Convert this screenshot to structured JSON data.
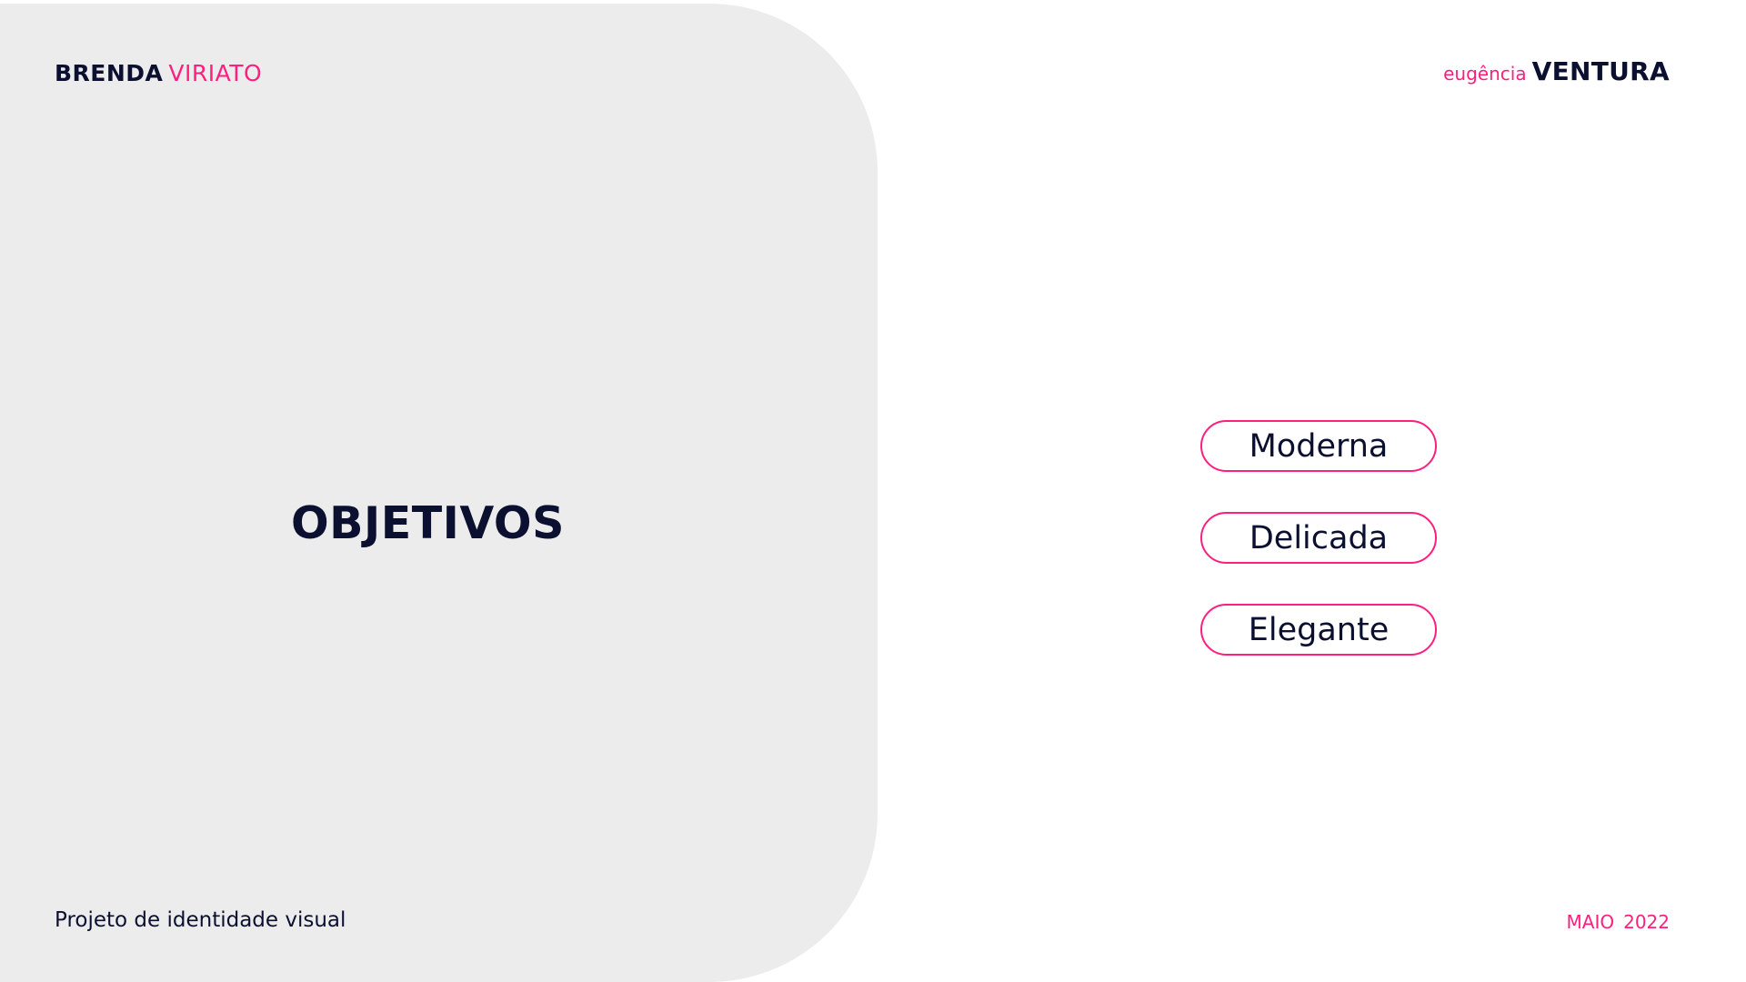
{
  "header": {
    "left_brand": {
      "first": "BRENDA",
      "last": "VIRIATO"
    },
    "right_brand": {
      "first": "eugência",
      "last": "VENTURA"
    }
  },
  "main": {
    "title": "OBJETIVOS",
    "objectives": [
      "Moderna",
      "Delicada",
      "Elegante"
    ]
  },
  "footer": {
    "project": "Projeto de identidade visual",
    "month": "MAIO",
    "year": "2022"
  },
  "colors": {
    "accent": "#ff1f7f",
    "text": "#0b1030",
    "panel": "#ececed",
    "background": "#ffffff"
  }
}
